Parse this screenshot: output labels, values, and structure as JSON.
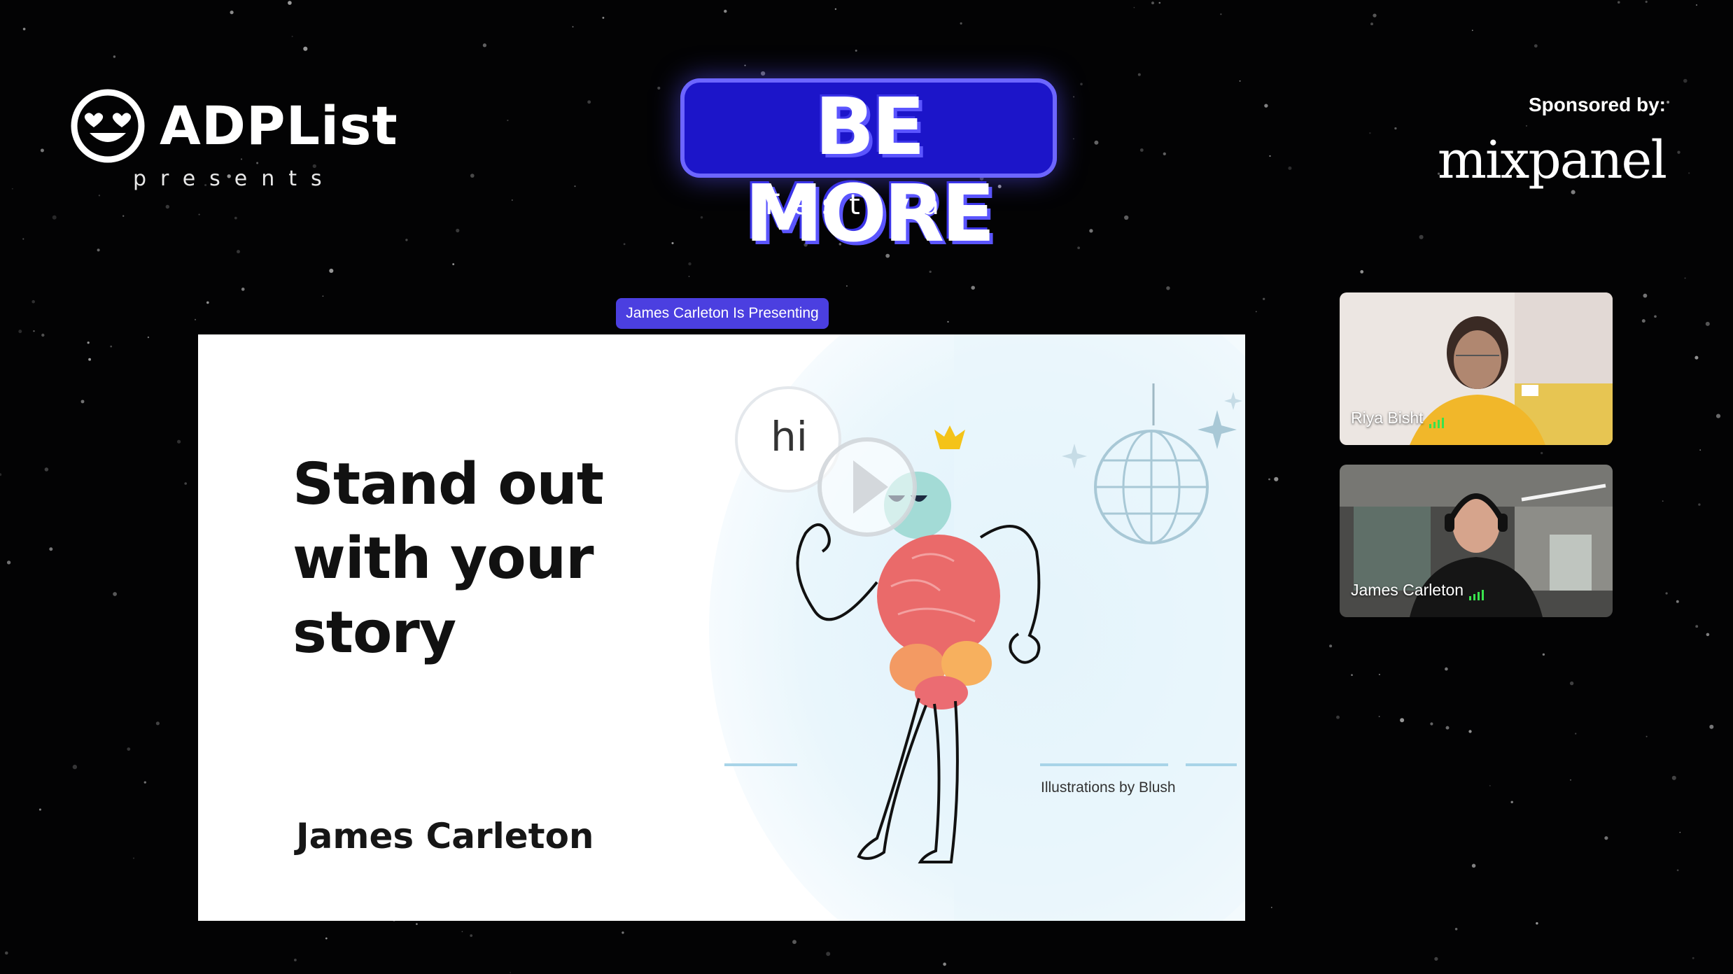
{
  "header": {
    "organizer": {
      "name": "ADPList",
      "tagline": "presents",
      "logo_icon": "heart-eyes-smiley-icon"
    },
    "event": {
      "title": "BE MORE",
      "subtitle": "Festival"
    },
    "sponsor": {
      "label": "Sponsored by:",
      "name": "mixpanel"
    }
  },
  "stage": {
    "presenting_badge": "James Carleton Is Presenting",
    "slide": {
      "headline": [
        "Stand out",
        "with your",
        "story"
      ],
      "presenter": "James Carleton",
      "greeting": "hi",
      "credit": "Illustrations by Blush",
      "play_icon": "play-icon"
    }
  },
  "participants": [
    {
      "name": "Riya Bisht",
      "mic_icon": "mic-level-icon"
    },
    {
      "name": "James Carleton",
      "mic_icon": "mic-level-icon"
    }
  ],
  "colors": {
    "background": "#030304",
    "badge": "#4b3fe0",
    "event_logo": "#1c15c9",
    "mic_active": "#39e24d"
  }
}
